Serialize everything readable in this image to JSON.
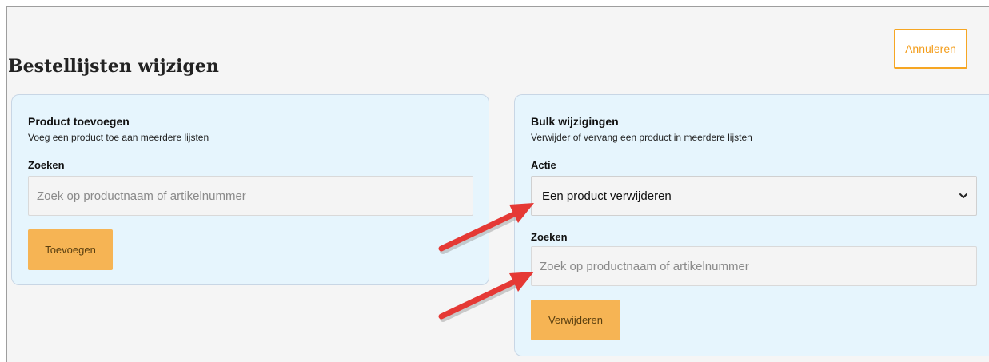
{
  "page": {
    "title": "Bestellijsten wijzigen",
    "cancel_label": "Annuleren"
  },
  "add_product": {
    "title": "Product toevoegen",
    "subtitle": "Voeg een product toe aan meerdere lijsten",
    "search_label": "Zoeken",
    "search_placeholder": "Zoek op productnaam of artikelnummer",
    "search_value": "",
    "button_label": "Toevoegen"
  },
  "bulk_changes": {
    "title": "Bulk wijzigingen",
    "subtitle": "Verwijder of vervang een product in meerdere lijsten",
    "action_label": "Actie",
    "action_selected": "Een product verwijderen",
    "search_label": "Zoeken",
    "search_placeholder": "Zoek op productnaam of artikelnummer",
    "search_value": "",
    "button_label": "Verwijderen"
  },
  "colors": {
    "accent_orange": "#f6a623",
    "button_fill": "#f6b454",
    "card_background": "#e6f5fd",
    "annotation_arrow": "#e53935"
  },
  "icons": {
    "select_chevron": "chevron-down-icon",
    "annotation": "annotation-arrow-icon"
  }
}
